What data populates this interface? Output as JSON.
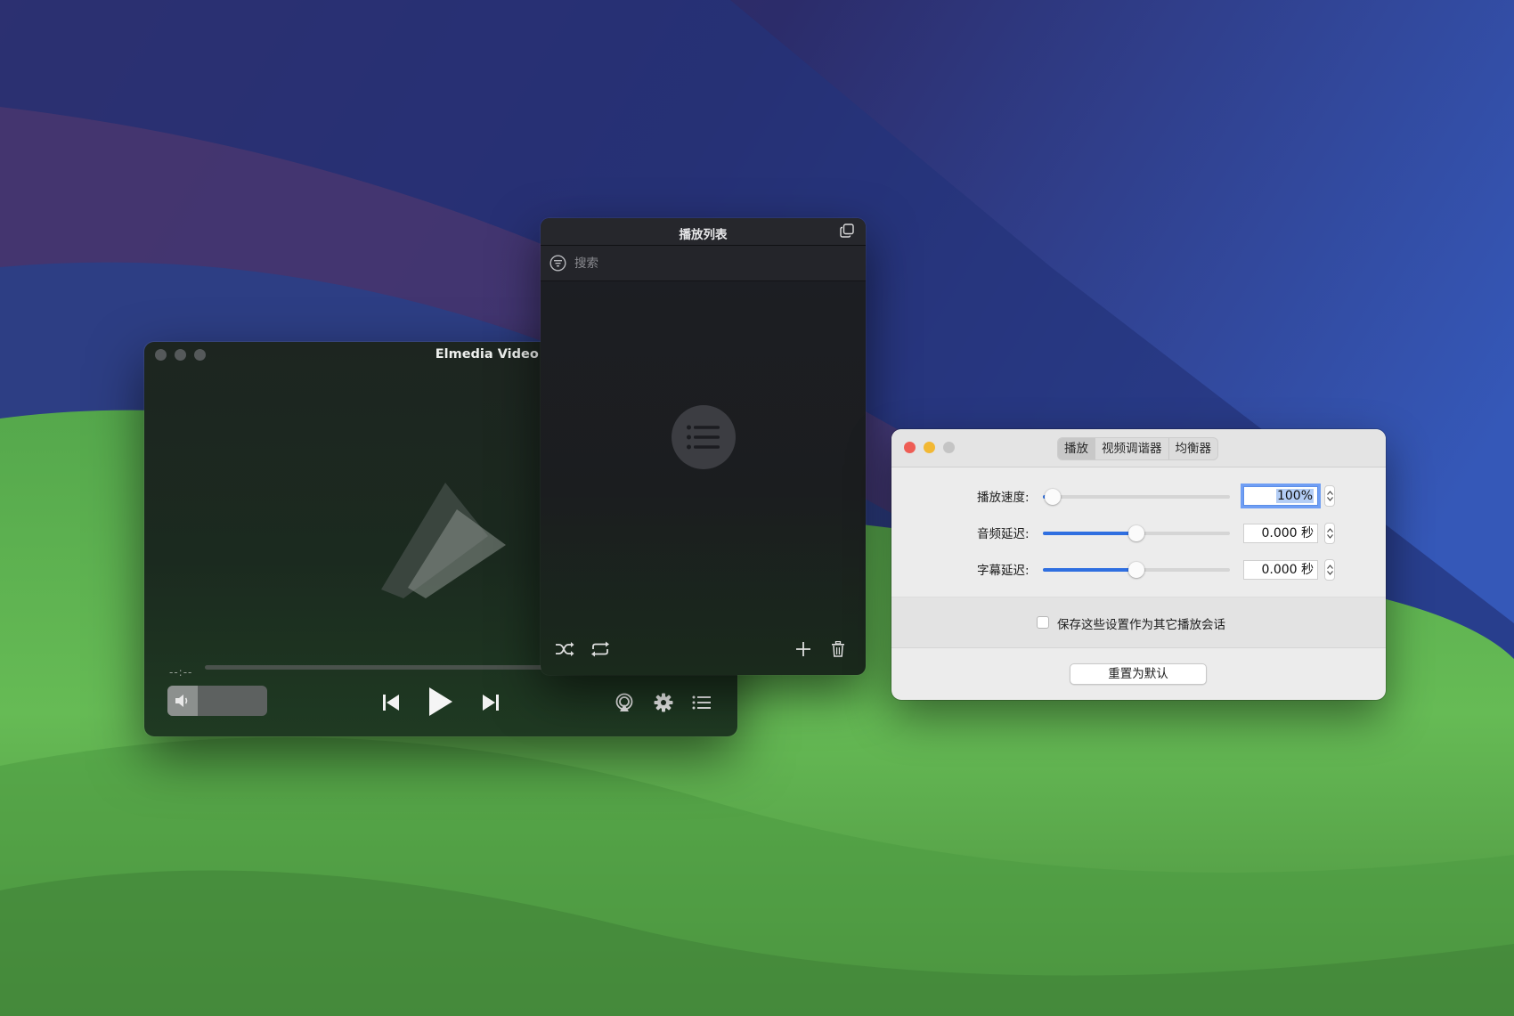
{
  "player": {
    "title": "Elmedia Video Player",
    "time": "--:--",
    "progress": 0,
    "volume_level": 0.3,
    "icons": {
      "volume": "speaker-icon",
      "previous": "skip-back-icon",
      "play": "play-icon",
      "next": "skip-forward-icon",
      "airplay": "airplay-icon",
      "settings": "gear-icon",
      "playlist": "list-icon"
    }
  },
  "playlist": {
    "title": "播放列表",
    "search_placeholder": "搜索",
    "icons": {
      "detach": "copy-window-icon",
      "filter": "filter-icon",
      "empty": "list-icon",
      "shuffle": "shuffle-icon",
      "repeat": "repeat-icon",
      "add": "plus-icon",
      "delete": "trash-icon"
    }
  },
  "settings": {
    "tabs": [
      {
        "label": "播放",
        "active": true
      },
      {
        "label": "视频调谐器",
        "active": false
      },
      {
        "label": "均衡器",
        "active": false
      }
    ],
    "rows": [
      {
        "label": "播放速度:",
        "value": "100%",
        "slider_fraction": 0.05
      },
      {
        "label": "音频延迟:",
        "value": "0.000 秒",
        "slider_fraction": 0.5
      },
      {
        "label": "字幕延迟:",
        "value": "0.000 秒",
        "slider_fraction": 0.5
      }
    ],
    "save_checkbox_label": "保存这些设置作为其它播放会话",
    "save_checked": false,
    "reset_button": "重置为默认",
    "colors": {
      "accent": "#2f6fe0",
      "close": "#ee5d55",
      "minimize": "#f2b834",
      "zoom": "#c4c4c4"
    }
  }
}
